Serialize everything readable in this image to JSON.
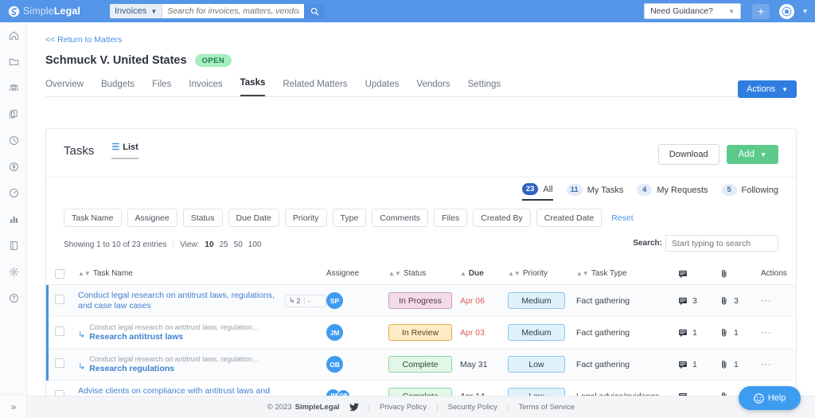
{
  "topbar": {
    "brand_thin": "Simple",
    "brand_bold": "Legal",
    "search_scope": "Invoices",
    "search_placeholder": "Search for invoices, matters, vendors...",
    "guidance_label": "Need Guidance?",
    "accent": "#5495e8"
  },
  "rail": {
    "items": [
      {
        "icon": "home-icon"
      },
      {
        "icon": "folder-icon"
      },
      {
        "icon": "vendors-icon"
      },
      {
        "icon": "documents-icon"
      },
      {
        "icon": "clock-icon"
      },
      {
        "icon": "dollar-icon"
      },
      {
        "icon": "gauge-icon"
      },
      {
        "icon": "bar-chart-icon"
      },
      {
        "icon": "book-icon"
      },
      {
        "icon": "gear-icon"
      },
      {
        "icon": "help-circle-icon"
      }
    ],
    "expand_glyph": "»"
  },
  "header": {
    "breadcrumb": "<< Return to Matters",
    "matter_title": "Schmuck V. United States",
    "status_badge": "OPEN",
    "actions_label": "Actions",
    "tabs": [
      {
        "label": "Overview",
        "active": false
      },
      {
        "label": "Budgets",
        "active": false
      },
      {
        "label": "Files",
        "active": false
      },
      {
        "label": "Invoices",
        "active": false
      },
      {
        "label": "Tasks",
        "active": true
      },
      {
        "label": "Related Matters",
        "active": false
      },
      {
        "label": "Updates",
        "active": false
      },
      {
        "label": "Vendors",
        "active": false
      },
      {
        "label": "Settings",
        "active": false
      }
    ]
  },
  "card": {
    "title": "Tasks",
    "view_toggle": "List",
    "download_label": "Download",
    "add_label": "Add",
    "filter_tabs": [
      {
        "count": "23",
        "label": "All",
        "active": true
      },
      {
        "count": "11",
        "label": "My Tasks",
        "active": false
      },
      {
        "count": "4",
        "label": "My Requests",
        "active": false
      },
      {
        "count": "5",
        "label": "Following",
        "active": false
      }
    ],
    "filter_chips": [
      "Task Name",
      "Assignee",
      "Status",
      "Due Date",
      "Priority",
      "Type",
      "Comments",
      "Files",
      "Created By",
      "Created Date"
    ],
    "reset_label": "Reset",
    "showing_text": "Showing 1 to 10 of 23 entries",
    "view_label": "View:",
    "view_options": [
      {
        "value": "10",
        "active": true
      },
      {
        "value": "25",
        "active": false
      },
      {
        "value": "50",
        "active": false
      },
      {
        "value": "100",
        "active": false
      }
    ],
    "search_label": "Search:",
    "search_placeholder": "Start typing to search"
  },
  "table": {
    "columns": {
      "task_name": "Task Name",
      "assignee": "Assignee",
      "status": "Status",
      "due": "Due",
      "priority": "Priority",
      "task_type": "Task Type",
      "comments_icon": "comment-icon",
      "files_icon": "paperclip-icon",
      "actions": "Actions"
    },
    "rows": [
      {
        "name": "Conduct legal research on antitrust laws, regulations, and case law cases",
        "parent": "",
        "is_sub": false,
        "subcount": "2",
        "subcount_secondary": "-",
        "assignees": [
          "SP"
        ],
        "status": "In Progress",
        "status_kind": "inprogress",
        "due": "Apr 06",
        "due_overdue": true,
        "priority": "Medium",
        "task_type": "Fact gathering",
        "comments": "3",
        "files": "3",
        "shaded": true,
        "marked": true
      },
      {
        "name": "Research antitrust laws",
        "parent": "Conduct legal research on antitrust laws, regulation...",
        "is_sub": true,
        "subcount": "",
        "subcount_secondary": "",
        "assignees": [
          "JM"
        ],
        "status": "In Review",
        "status_kind": "inreview",
        "due": "Apr 03",
        "due_overdue": true,
        "priority": "Medium",
        "task_type": "Fact gathering",
        "comments": "1",
        "files": "1",
        "shaded": false,
        "marked": true
      },
      {
        "name": "Research regulations",
        "parent": "Conduct legal research on antitrust laws, regulation...",
        "is_sub": true,
        "subcount": "",
        "subcount_secondary": "",
        "assignees": [
          "OB"
        ],
        "status": "Complete",
        "status_kind": "complete",
        "due": "May 31",
        "due_overdue": false,
        "priority": "Low",
        "task_type": "Fact gathering",
        "comments": "1",
        "files": "1",
        "shaded": true,
        "marked": true
      },
      {
        "name": "Advise clients on compliance with antitrust laws and regulations",
        "parent": "",
        "is_sub": false,
        "subcount": "",
        "subcount_secondary": "",
        "assignees": [
          "JM",
          "OB"
        ],
        "status": "Complete",
        "status_kind": "complete",
        "due": "Apr 14",
        "due_overdue": false,
        "priority": "Low",
        "task_type": "Legal advice/guidance",
        "comments": "----",
        "files": "----",
        "shaded": false,
        "marked": false
      }
    ]
  },
  "footer": {
    "copyright": "© 2023",
    "brand": "SimpleLegal",
    "twitter_icon": "twitter-icon",
    "links": [
      "Privacy Policy",
      "Security Policy",
      "Terms of Service"
    ]
  },
  "help": {
    "label": "Help",
    "icon": "help-smiley-icon"
  }
}
